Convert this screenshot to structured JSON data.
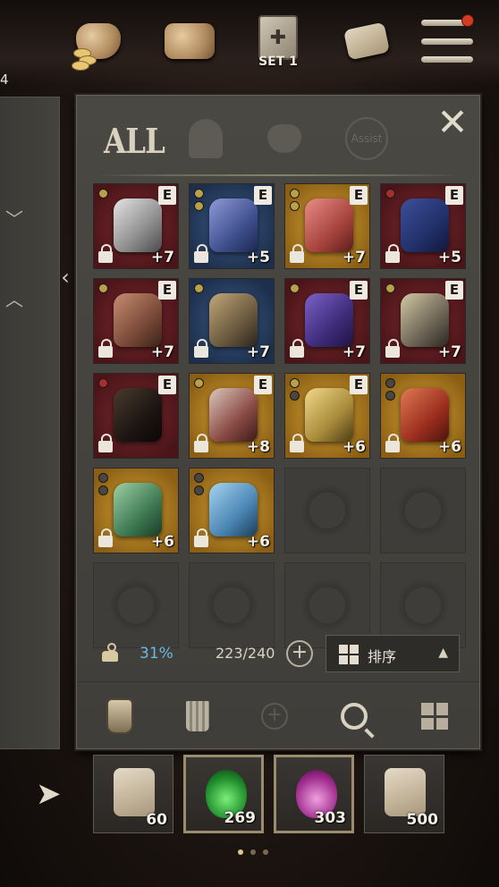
{
  "topbar": {
    "icons": [
      {
        "name": "currency-bag-icon"
      },
      {
        "name": "storage-bag-icon"
      },
      {
        "name": "equipment-set-book-icon",
        "label": "SET 1"
      },
      {
        "name": "quest-scroll-icon"
      },
      {
        "name": "main-menu-icon",
        "notification": true
      }
    ],
    "set_label": "SET 1",
    "corner_number": "4"
  },
  "tabs": {
    "active": "ALL",
    "all_label": "ALL",
    "assist_label": "Assist",
    "items": [
      "ALL",
      "helmet",
      "pouch",
      "Assist"
    ]
  },
  "inventory": {
    "slots": [
      {
        "bg": "red",
        "art": "steel",
        "badge": "E",
        "gems": [
          "gold"
        ],
        "locked": true,
        "level": "+7"
      },
      {
        "bg": "blue",
        "art": "blue",
        "badge": "E",
        "gems": [
          "gold",
          "gold"
        ],
        "locked": true,
        "level": "+5"
      },
      {
        "bg": "gold",
        "art": "pink",
        "badge": "E",
        "gems": [
          "gold",
          "gold"
        ],
        "locked": true,
        "level": "+7"
      },
      {
        "bg": "red",
        "art": "navy",
        "badge": "E",
        "gems": [
          "red"
        ],
        "locked": true,
        "level": "+5"
      },
      {
        "bg": "red",
        "art": "copper",
        "badge": "E",
        "gems": [
          "gold"
        ],
        "locked": true,
        "level": "+7"
      },
      {
        "bg": "blue",
        "art": "chain",
        "badge": "",
        "gems": [
          "gold"
        ],
        "locked": true,
        "level": "+7"
      },
      {
        "bg": "red",
        "art": "violet",
        "badge": "E",
        "gems": [
          "gold"
        ],
        "locked": true,
        "level": "+7"
      },
      {
        "bg": "red",
        "art": "gauntlet",
        "badge": "E",
        "gems": [
          "gold"
        ],
        "locked": true,
        "level": "+7"
      },
      {
        "bg": "red",
        "art": "black",
        "badge": "E",
        "gems": [
          "red"
        ],
        "locked": true,
        "level": ""
      },
      {
        "bg": "gold",
        "art": "pauldron",
        "badge": "E",
        "gems": [
          "gold"
        ],
        "locked": true,
        "level": "+8"
      },
      {
        "bg": "gold",
        "art": "goldmask",
        "badge": "E",
        "gems": [
          "gold",
          "empty"
        ],
        "locked": true,
        "level": "+6"
      },
      {
        "bg": "gold",
        "art": "redmask",
        "badge": "",
        "gems": [
          "empty",
          "empty"
        ],
        "locked": true,
        "level": "+6"
      },
      {
        "bg": "gold",
        "art": "greenmask",
        "badge": "",
        "gems": [
          "empty",
          "empty"
        ],
        "locked": true,
        "level": "+6"
      },
      {
        "bg": "gold",
        "art": "bluemask",
        "badge": "",
        "gems": [
          "empty",
          "empty"
        ],
        "locked": true,
        "level": "+6"
      },
      {
        "empty": true
      },
      {
        "empty": true
      },
      {
        "empty": true
      },
      {
        "empty": true
      },
      {
        "empty": true
      },
      {
        "empty": true
      }
    ]
  },
  "stats": {
    "weight_percent": "31%",
    "capacity": "223/240",
    "expand_symbol": "+",
    "sort_label": "排序"
  },
  "actions": [
    {
      "name": "potion-action-icon"
    },
    {
      "name": "trash-bin-icon"
    },
    {
      "name": "add-disabled-icon"
    },
    {
      "name": "search-magnifier-icon"
    },
    {
      "name": "grid-view-icon"
    }
  ],
  "quickslots": [
    {
      "name": "return-scroll",
      "count": "60",
      "selected": false
    },
    {
      "name": "green-potion",
      "count": "269",
      "selected": true
    },
    {
      "name": "pink-potion",
      "count": "303",
      "selected": true
    },
    {
      "name": "teleport-scroll",
      "count": "500",
      "selected": false
    }
  ],
  "colors": {
    "weight_text": "#6cb8e6",
    "rarity_red": "#7e2a2f",
    "rarity_blue": "#3e5e8a",
    "rarity_gold": "#d6a235"
  }
}
